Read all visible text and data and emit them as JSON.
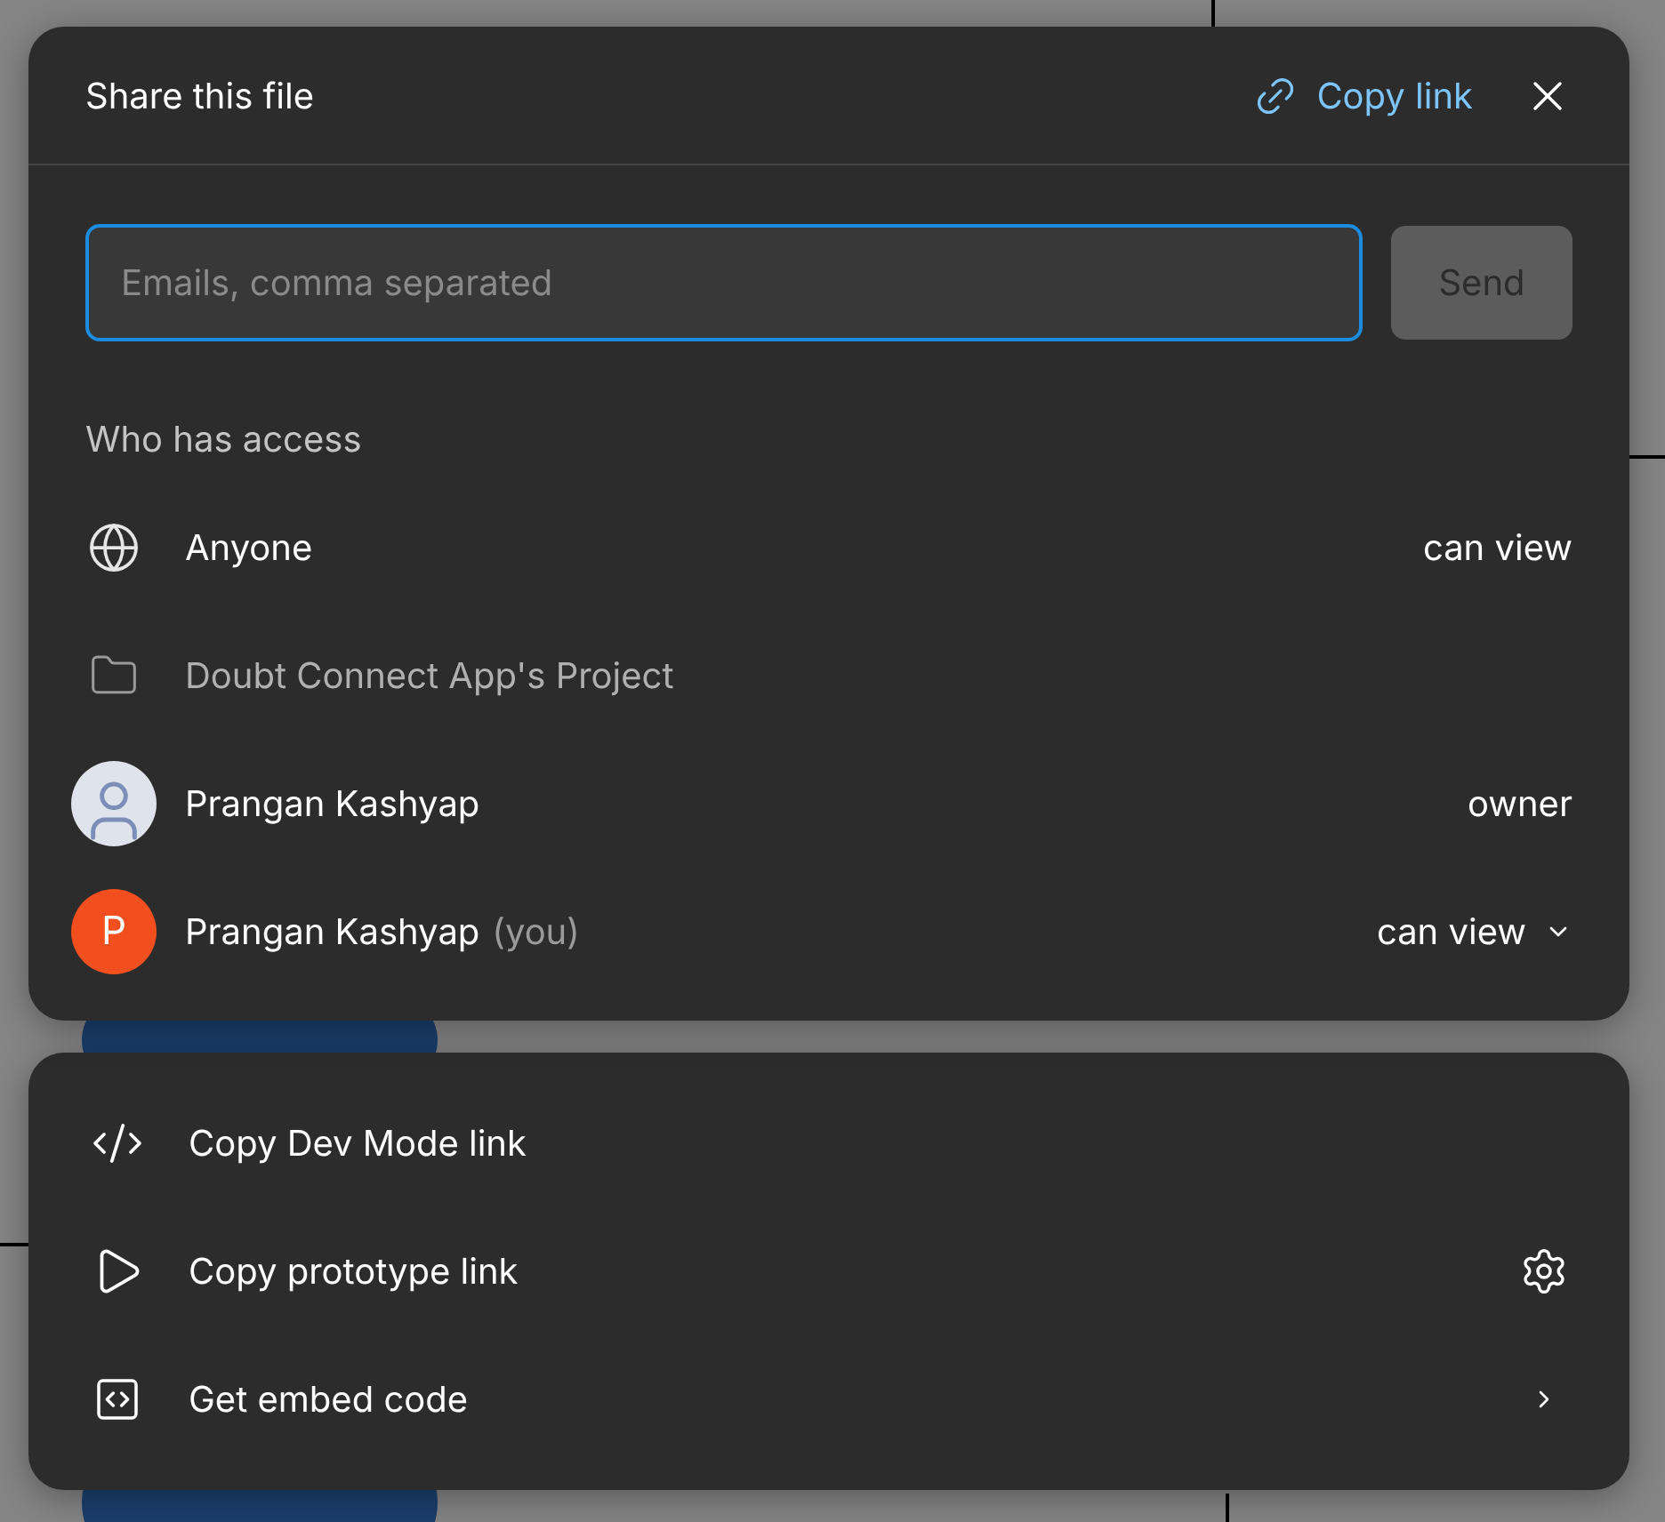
{
  "dialog": {
    "title": "Share this file",
    "copy_link": "Copy link"
  },
  "invite": {
    "placeholder": "Emails, comma separated",
    "focused": true,
    "send": {
      "label": "Send",
      "disabled": true
    }
  },
  "access": {
    "heading": "Who has access",
    "members": [
      {
        "kind": "globe",
        "name": "Anyone",
        "role": "can view",
        "muted": false
      },
      {
        "kind": "folder",
        "name": "Doubt Connect App's Project",
        "muted": true
      },
      {
        "kind": "photo",
        "name": "Prangan Kashyap",
        "role": "owner",
        "muted": false
      },
      {
        "kind": "letter",
        "initial": "P",
        "color": "#f24e1e",
        "name": "Prangan Kashyap",
        "suffix": "(you)",
        "role": "can view",
        "has_menu": true,
        "muted": false
      }
    ]
  },
  "links": [
    {
      "kind": "code",
      "label": "Copy Dev Mode link"
    },
    {
      "kind": "play",
      "label": "Copy prototype link",
      "has_settings": true
    },
    {
      "kind": "embed",
      "label": "Get embed code",
      "has_submenu": true
    }
  ]
}
